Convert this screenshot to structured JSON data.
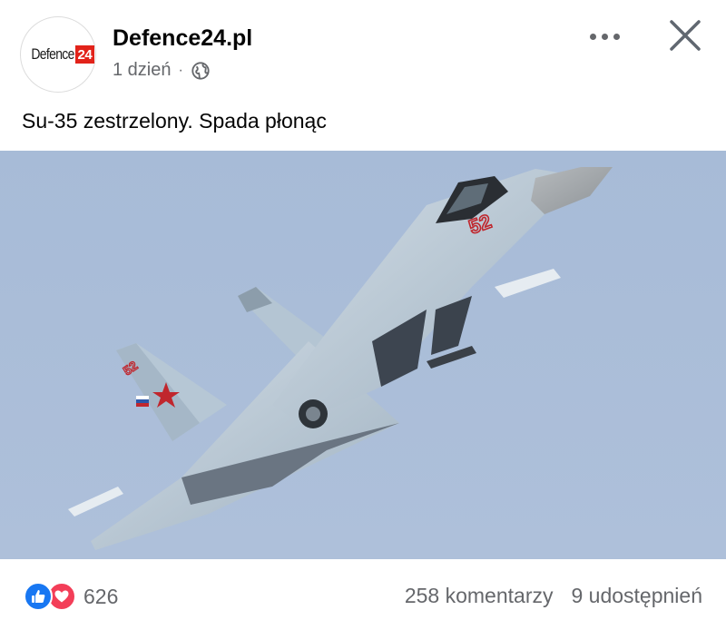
{
  "post": {
    "page_name": "Defence24.pl",
    "logo_text": "Defence",
    "logo_number": "24",
    "time": "1 dzień",
    "separator": "·",
    "audience_icon": "globe-icon",
    "text": "Su-35 zestrzelony. Spada płonąc"
  },
  "photo": {
    "subject": "fighter-jet-image",
    "sky_color": "#a9bdd8",
    "aircraft_color": "#b9c9d6",
    "tail_number": "52",
    "star_color": "#c0262d"
  },
  "footer": {
    "reaction_icons": [
      "like-icon",
      "love-icon"
    ],
    "reaction_count": "626",
    "comments": "258 komentarzy",
    "shares": "9 udostępnień"
  },
  "colors": {
    "secondary_text": "#65676b",
    "like_blue": "#1877f2",
    "love_red": "#f33e58",
    "logo_red": "#e2231a"
  }
}
